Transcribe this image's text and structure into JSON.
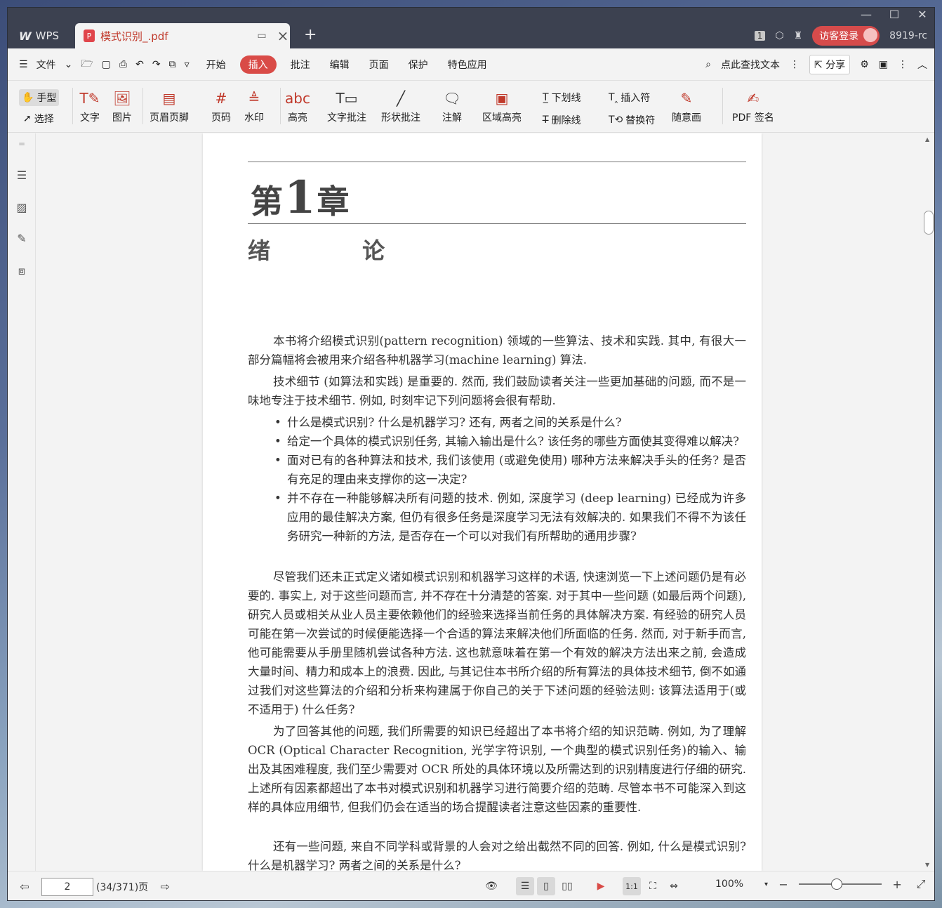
{
  "titlebar": {
    "app_name": "WPS",
    "doc_tab_title": "模式识别_.pdf",
    "pdf_badge": "P",
    "login_label": "访客登录",
    "user_id": "8919-rc",
    "page_badge": "1"
  },
  "menubar": {
    "file_label": "文件",
    "items": [
      "开始",
      "插入",
      "批注",
      "编辑",
      "页面",
      "保护",
      "特色应用"
    ],
    "active": "插入",
    "search_label": "点此查找文本",
    "share_label": "分享"
  },
  "ribbon": {
    "hand": "手型",
    "select": "选择",
    "text": "文字",
    "image": "图片",
    "header_footer": "页眉页脚",
    "page_num": "页码",
    "watermark": "水印",
    "highlight": "高亮",
    "text_comment": "文字批注",
    "shape_comment": "形状批注",
    "note": "注解",
    "area_highlight": "区域高亮",
    "underline": "下划线",
    "strikethrough": "删除线",
    "insert_mark": "插入符",
    "replace_mark": "替换符",
    "freehand": "随意画",
    "pdf_sign": "PDF 签名"
  },
  "page": {
    "chapter_prefix": "第",
    "chapter_num": "1",
    "chapter_suffix": "章",
    "chapter_title": "绪 论",
    "p1": "本书将介绍模式识别(pattern recognition) 领域的一些算法、技术和实践. 其中, 有很大一部分篇幅将会被用来介绍各种机器学习(machine learning) 算法.",
    "p2": "技术细节 (如算法和实践) 是重要的. 然而, 我们鼓励读者关注一些更加基础的问题, 而不是一味地专注于技术细节. 例如, 时刻牢记下列问题将会很有帮助.",
    "bullets": [
      "什么是模式识别? 什么是机器学习? 还有, 两者之间的关系是什么?",
      "给定一个具体的模式识别任务, 其输入输出是什么? 该任务的哪些方面使其变得难以解决?",
      "面对已有的各种算法和技术, 我们该使用 (或避免使用) 哪种方法来解决手头的任务? 是否有充足的理由来支撑你的这一决定?",
      "并不存在一种能够解决所有问题的技术. 例如, 深度学习 (deep learning) 已经成为许多应用的最佳解决方案, 但仍有很多任务是深度学习无法有效解决的. 如果我们不得不为该任务研究一种新的方法, 是否存在一个可以对我们有所帮助的通用步骤?"
    ],
    "p3": "尽管我们还未正式定义诸如模式识别和机器学习这样的术语, 快速浏览一下上述问题仍是有必要的. 事实上, 对于这些问题而言, 并不存在十分清楚的答案. 对于其中一些问题 (如最后两个问题), 研究人员或相关从业人员主要依赖他们的经验来选择当前任务的具体解决方案. 有经验的研究人员可能在第一次尝试的时候便能选择一个合适的算法来解决他们所面临的任务. 然而, 对于新手而言, 他可能需要从手册里随机尝试各种方法. 这也就意味着在第一个有效的解决方法出来之前, 会造成大量时间、精力和成本上的浪费. 因此, 与其记住本书所介绍的所有算法的具体技术细节, 倒不如通过我们对这些算法的介绍和分析来构建属于你自己的关于下述问题的经验法则: 该算法适用于(或不适用于) 什么任务?",
    "p4": "为了回答其他的问题, 我们所需要的知识已经超出了本书将介绍的知识范畴. 例如, 为了理解 OCR (Optical Character Recognition, 光学字符识别, 一个典型的模式识别任务)的输入、输出及其困难程度, 我们至少需要对 OCR 所处的具体环境以及所需达到的识别精度进行仔细的研究. 上述所有因素都超出了本书对模式识别和机器学习进行简要介绍的范畴. 尽管本书不可能深入到这样的具体应用细节, 但我们仍会在适当的场合提醒读者注意这些因素的重要性.",
    "p5": "还有一些问题, 来自不同学科或背景的人会对之给出截然不同的回答. 例如, 什么是模式识别? 什么是机器学习? 两者之间的关系是什么?"
  },
  "statusbar": {
    "page_value": "2",
    "page_info": "(34/371)页",
    "zoom": "100%",
    "zoom_level": 0.46
  }
}
